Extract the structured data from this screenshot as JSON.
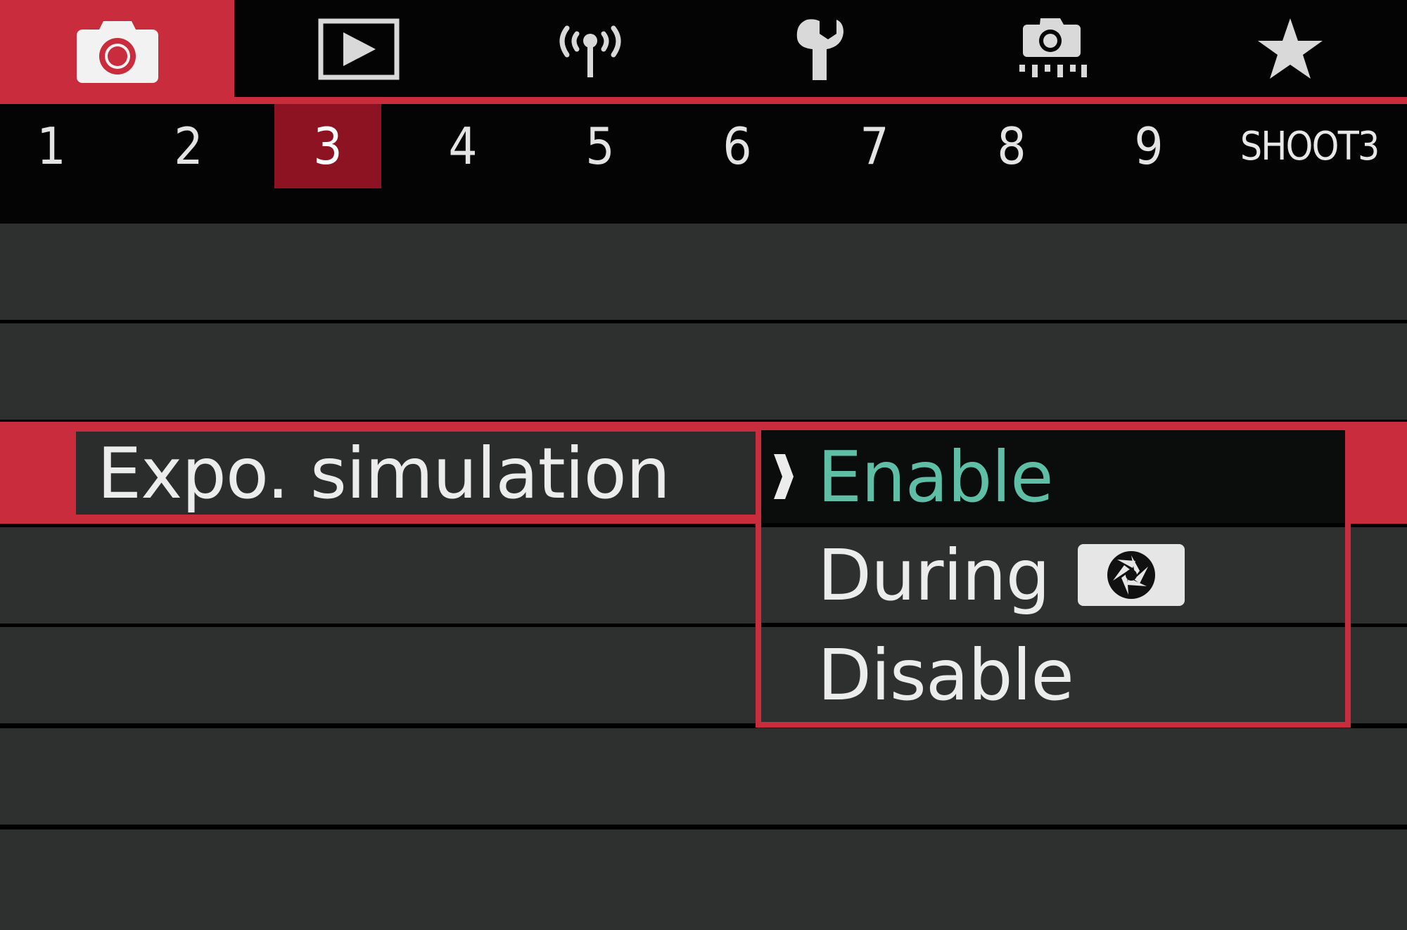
{
  "category_tabs": [
    {
      "name": "shooting",
      "icon": "camera-icon",
      "active": true
    },
    {
      "name": "playback",
      "icon": "play-icon",
      "active": false
    },
    {
      "name": "wireless",
      "icon": "wireless-icon",
      "active": false
    },
    {
      "name": "setup",
      "icon": "wrench-icon",
      "active": false
    },
    {
      "name": "custom-functions",
      "icon": "camera-settings-icon",
      "active": false
    },
    {
      "name": "my-menu",
      "icon": "star-icon",
      "active": false
    }
  ],
  "page_tabs": [
    "1",
    "2",
    "3",
    "4",
    "5",
    "6",
    "7",
    "8",
    "9"
  ],
  "active_page": "3",
  "page_name": "SHOOT3",
  "menu_item": {
    "label": "Expo. simulation"
  },
  "options": [
    {
      "label": "Enable",
      "selected": true
    },
    {
      "label": "During",
      "icon": "aperture-icon",
      "selected": false
    },
    {
      "label": "Disable",
      "selected": false
    }
  ],
  "colors": {
    "accent_red": "#c92c3c",
    "active_page_red": "#8e1322",
    "row_gray": "#2d302f",
    "selected_text": "#5fbfa6"
  }
}
